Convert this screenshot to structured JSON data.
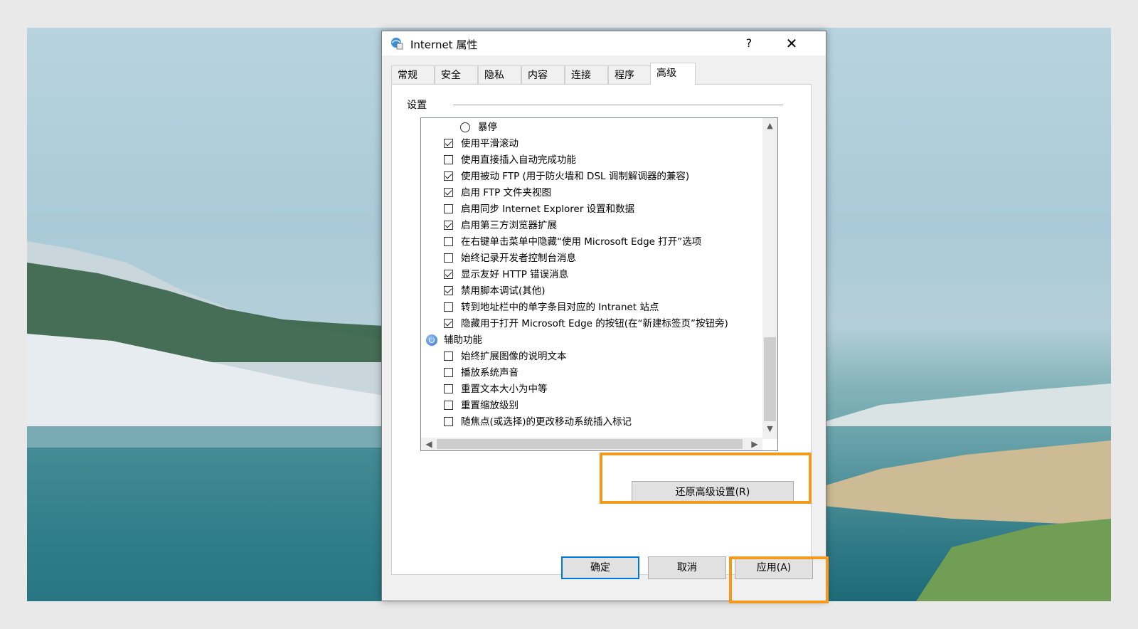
{
  "window": {
    "title": "Internet 属性",
    "help_label": "?",
    "close_label": "✕"
  },
  "tabs": [
    {
      "label": "常规",
      "active": false
    },
    {
      "label": "安全",
      "active": false
    },
    {
      "label": "隐私",
      "active": false
    },
    {
      "label": "内容",
      "active": false
    },
    {
      "label": "连接",
      "active": false
    },
    {
      "label": "程序",
      "active": false
    },
    {
      "label": "高级",
      "active": true
    }
  ],
  "settings": {
    "group_label": "设置",
    "items": [
      {
        "type": "radio",
        "label": "暴停",
        "checked": false
      },
      {
        "type": "checkbox",
        "label": "使用平滑滚动",
        "checked": true
      },
      {
        "type": "checkbox",
        "label": "使用直接插入自动完成功能",
        "checked": false
      },
      {
        "type": "checkbox",
        "label": "使用被动 FTP (用于防火墙和 DSL 调制解调器的兼容)",
        "checked": true
      },
      {
        "type": "checkbox",
        "label": "启用 FTP 文件夹视图",
        "checked": true
      },
      {
        "type": "checkbox",
        "label": "启用同步 Internet Explorer 设置和数据",
        "checked": false
      },
      {
        "type": "checkbox",
        "label": "启用第三方浏览器扩展",
        "checked": true
      },
      {
        "type": "checkbox",
        "label": "在右键单击菜单中隐藏“使用 Microsoft Edge 打开”选项",
        "checked": false
      },
      {
        "type": "checkbox",
        "label": "始终记录开发者控制台消息",
        "checked": false
      },
      {
        "type": "checkbox",
        "label": "显示友好 HTTP 错误消息",
        "checked": true
      },
      {
        "type": "checkbox",
        "label": "禁用脚本调试(其他)",
        "checked": true
      },
      {
        "type": "checkbox",
        "label": "转到地址栏中的单字条目对应的 Intranet 站点",
        "checked": false
      },
      {
        "type": "checkbox",
        "label": "隐藏用于打开 Microsoft Edge 的按钮(在“新建标签页”按钮旁)",
        "checked": true
      },
      {
        "type": "group",
        "label": "辅助功能"
      },
      {
        "type": "checkbox",
        "label": "始终扩展图像的说明文本",
        "checked": false
      },
      {
        "type": "checkbox",
        "label": "播放系统声音",
        "checked": false
      },
      {
        "type": "checkbox",
        "label": "重置文本大小为中等",
        "checked": false
      },
      {
        "type": "checkbox",
        "label": "重置缩放级别",
        "checked": false
      },
      {
        "type": "checkbox",
        "label": "随焦点(或选择)的更改移动系统插入标记",
        "checked": false
      }
    ]
  },
  "buttons": {
    "restore": "还原高级设置(R)",
    "ok": "确定",
    "cancel": "取消",
    "apply": "应用(A)"
  },
  "colors": {
    "highlight": "#f39a1e",
    "default_button_border": "#0078d7"
  }
}
